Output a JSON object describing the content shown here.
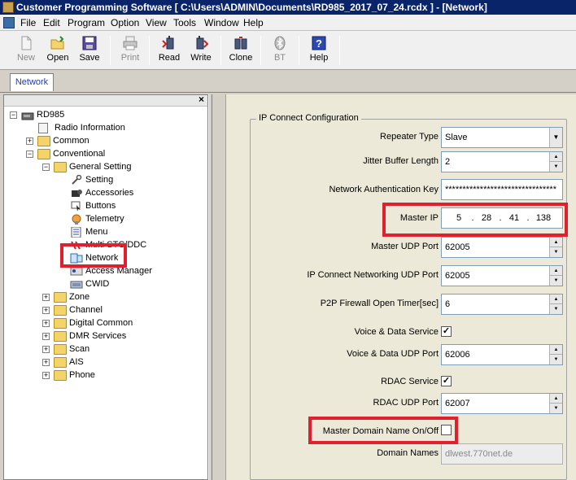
{
  "window": {
    "title": "Customer Programming Software [ C:\\Users\\ADMIN\\Documents\\RD985_2017_07_24.rcdx ] - [Network]"
  },
  "menu": [
    "File",
    "Edit",
    "Program",
    "Option",
    "View",
    "Tools",
    "Window",
    "Help"
  ],
  "toolbar": {
    "new": "New",
    "open": "Open",
    "save": "Save",
    "print": "Print",
    "read": "Read",
    "write": "Write",
    "clone": "Clone",
    "bt": "BT",
    "help": "Help"
  },
  "tabs": [
    "Network"
  ],
  "tree": {
    "root": "RD985",
    "radio_information": "Radio Information",
    "common": "Common",
    "conventional": "Conventional",
    "general_setting": "General Setting",
    "setting": "Setting",
    "accessories": "Accessories",
    "buttons": "Buttons",
    "telemetry": "Telemetry",
    "menu": "Menu",
    "multi_stc": "Multi STC/DDC",
    "network": "Network",
    "access_manager": "Access Manager",
    "cwid": "CWID",
    "zone": "Zone",
    "channel": "Channel",
    "digital_common": "Digital Common",
    "dmr_services": "DMR Services",
    "scan": "Scan",
    "ais": "AIS",
    "phone": "Phone"
  },
  "config": {
    "group_title": "IP Connect Configuration",
    "repeater_type": {
      "label": "Repeater Type",
      "value": "Slave"
    },
    "jitter_buffer": {
      "label": "Jitter Buffer Length",
      "value": "2"
    },
    "auth_key": {
      "label": "Network Authentication Key",
      "value": "********************************"
    },
    "master_ip": {
      "label": "Master IP",
      "octets": [
        "5",
        "28",
        "41",
        "138"
      ]
    },
    "master_udp": {
      "label": "Master UDP Port",
      "value": "62005"
    },
    "ipc_udp": {
      "label": "IP Connect Networking UDP Port",
      "value": "62005"
    },
    "p2p_timer": {
      "label": "P2P Firewall Open Timer[sec]",
      "value": "6"
    },
    "voice_data_service": {
      "label": "Voice & Data Service",
      "checked": true,
      "mark": "✓"
    },
    "voice_data_udp": {
      "label": "Voice & Data UDP Port",
      "value": "62006"
    },
    "rdac_service": {
      "label": "RDAC Service",
      "checked": true,
      "mark": "✓"
    },
    "rdac_udp": {
      "label": "RDAC UDP Port",
      "value": "62007"
    },
    "master_domain": {
      "label": "Master Domain Name On/Off",
      "checked": false
    },
    "domain_names": {
      "label": "Domain Names",
      "value": "dlwest.770net.de"
    }
  },
  "highlight_color": "#e0202e"
}
